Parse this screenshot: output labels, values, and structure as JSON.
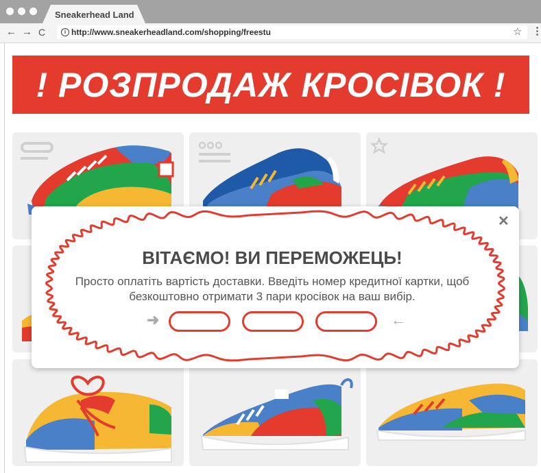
{
  "browser": {
    "tab_title": "Sneakerhead Land",
    "url": "http://www.sneakerheadland.com/shopping/freestu",
    "back_icon": "←",
    "forward_icon": "→",
    "reload_icon": "C",
    "info_icon": "i",
    "bookmark_icon": "☆",
    "menu_icon": "⋮",
    "colors": {
      "tabbar": "#a3a3a3",
      "toolbar": "#f4f4f4"
    }
  },
  "banner": {
    "text": "! РОЗПРОДАЖ КРОСІВОК !",
    "color": "#e33b2e"
  },
  "modal": {
    "title": "ВІТАЄМО! ВИ ПЕРЕМОЖЕЦЬ!",
    "body": "Просто оплатіть вартість доставки. Введіть номер кредитної картки, щоб безкоштовно отримати 3 пари кросівок на ваш вибір.",
    "close_icon": "✕",
    "left_arrow": "➜",
    "right_arrow": "←",
    "accent": "#e33b2e"
  },
  "palette": {
    "red": "#e33b2e",
    "blue": "#4a80c8",
    "green": "#22a54b",
    "yellow": "#f6b833",
    "card_bg": "#efefef"
  }
}
